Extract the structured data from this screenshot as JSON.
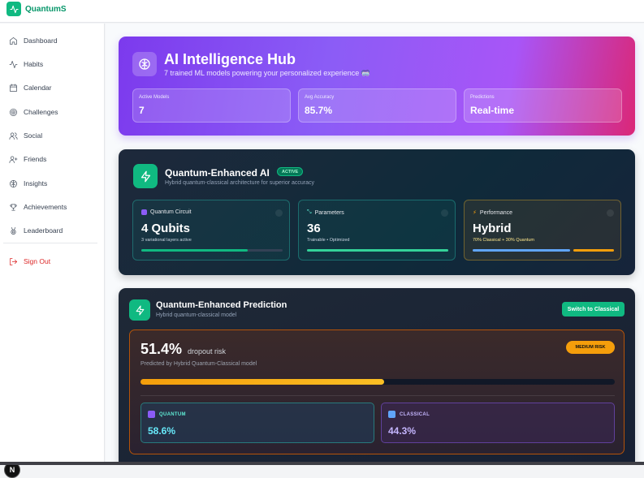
{
  "app": {
    "name": "QuantumS"
  },
  "sidebar": {
    "items": [
      {
        "label": "Dashboard",
        "icon": "home-icon"
      },
      {
        "label": "Habits",
        "icon": "activity-icon"
      },
      {
        "label": "Calendar",
        "icon": "calendar-icon"
      },
      {
        "label": "Challenges",
        "icon": "target-icon"
      },
      {
        "label": "Social",
        "icon": "users-icon"
      },
      {
        "label": "Friends",
        "icon": "user-plus-icon"
      },
      {
        "label": "Insights",
        "icon": "brain-icon"
      },
      {
        "label": "Achievements",
        "icon": "trophy-icon"
      },
      {
        "label": "Leaderboard",
        "icon": "medal-icon"
      }
    ],
    "signout": {
      "label": "Sign Out",
      "icon": "logout-icon"
    }
  },
  "hub": {
    "title": "AI Intelligence Hub",
    "subtitle": "7 trained ML models powering your personalized experience 🥽",
    "stats": [
      {
        "label": "Active Models",
        "value": "7"
      },
      {
        "label": "Avg Accuracy",
        "value": "85.7%"
      },
      {
        "label": "Predictions",
        "value": "Real-time"
      }
    ]
  },
  "quantum": {
    "title": "Quantum-Enhanced AI",
    "badge": "ACTIVE",
    "subtitle": "Hybrid quantum-classical architecture for superior accuracy",
    "boxes": [
      {
        "label": "Quantum Circuit",
        "value": "4 Qubits",
        "note": "3 variational layers active",
        "progress": 0.75
      },
      {
        "label": "Parameters",
        "value": "36",
        "note": "Trainable • Optimized",
        "progress": 1.0
      },
      {
        "label": "Performance",
        "value": "Hybrid",
        "note": "70% Classical + 30% Quantum",
        "split": [
          0.7,
          0.3
        ]
      }
    ]
  },
  "prediction": {
    "title": "Quantum-Enhanced Prediction",
    "subtitle": "Hybrid quantum-classical model",
    "switch_label": "Switch to Classical",
    "risk_value": "51.4%",
    "risk_label": "dropout risk",
    "risk_sub": "Predicted by Hybrid Quantum-Classical model",
    "risk_badge": "MEDIUM RISK",
    "risk_fraction": 0.514,
    "models": [
      {
        "label": "QUANTUM",
        "value": "58.6%"
      },
      {
        "label": "CLASSICAL",
        "value": "44.3%"
      }
    ]
  },
  "misc": {
    "dev_badge": "N"
  }
}
